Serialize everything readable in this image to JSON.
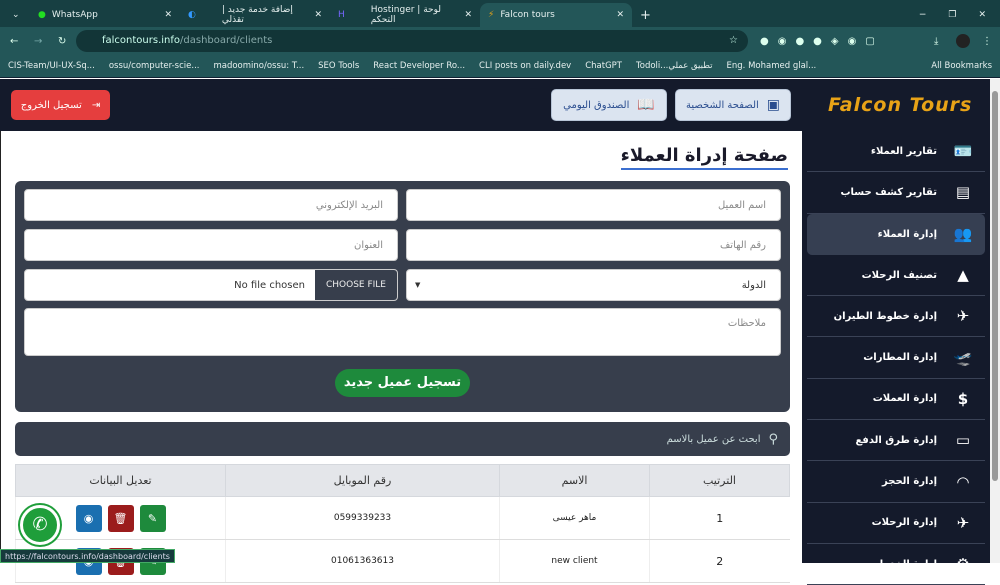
{
  "browser": {
    "tabs": [
      {
        "title": "WhatsApp"
      },
      {
        "title": "إضافة خدمة جديد | تقذلي"
      },
      {
        "title": "Hostinger | لوحة التحكم"
      },
      {
        "title": "Falcon tours"
      }
    ],
    "url_host": "falcontours.info",
    "url_path": "/dashboard/clients",
    "bookmarks": [
      "CIS-Team/UI-UX-Sq...",
      "ossu/computer-scie...",
      "madoomino/ossu: T...",
      "SEO Tools",
      "React Developer Ro...",
      "CLI posts on daily.dev",
      "ChatGPT",
      "Todoli...تطبيق عملي",
      "Eng. Mohamed glal..."
    ],
    "all_bookmarks": "All Bookmarks",
    "status_url": "https://falcontours.info/dashboard/clients"
  },
  "header": {
    "logout": "تسجيل الخروج",
    "daily_box": "الصندوق اليومي",
    "profile": "الصفحة الشخصية",
    "logo": "Falcon Tours"
  },
  "sidebar": {
    "items": [
      {
        "label": "تقارير العملاء",
        "icon": "id-card-icon"
      },
      {
        "label": "تقارير كشف حساب",
        "icon": "document-icon"
      },
      {
        "label": "إدارة العملاء",
        "icon": "users-icon"
      },
      {
        "label": "تصنيف الرحلات",
        "icon": "shapes-icon"
      },
      {
        "label": "إدارة خطوط الطيران",
        "icon": "airlines-icon"
      },
      {
        "label": "إدارة المطارات",
        "icon": "departure-icon"
      },
      {
        "label": "إدارة العملات",
        "icon": "dollar-icon"
      },
      {
        "label": "إدارة طرق الدفع",
        "icon": "card-icon"
      },
      {
        "label": "إدارة الحجز",
        "icon": "booking-icon"
      },
      {
        "label": "إدارة الرحلات",
        "icon": "plane-icon"
      },
      {
        "label": "إدارة الخدمات",
        "icon": "gear-icon"
      }
    ]
  },
  "page": {
    "title": "صفحة إدراة العملاء"
  },
  "form": {
    "name": "اسم العميل",
    "email": "البريد الإلكتروني",
    "phone": "رقم الهاتف",
    "address": "العنوان",
    "country": "الدولة",
    "file_button": "CHOOSE FILE",
    "file_status": "No file chosen",
    "notes": "ملاحظات",
    "submit": "تسجيل عميل جديد"
  },
  "search": {
    "placeholder": "ابحث عن عميل بالاسم"
  },
  "table": {
    "headers": [
      "الترتيب",
      "الاسم",
      "رقم الموبايل",
      "تعديل البيانات"
    ],
    "rows": [
      {
        "index": "1",
        "name": "ماهر عيسى",
        "mobile": "0599339233"
      },
      {
        "index": "2",
        "name": "new client",
        "mobile": "01061363613"
      }
    ]
  }
}
